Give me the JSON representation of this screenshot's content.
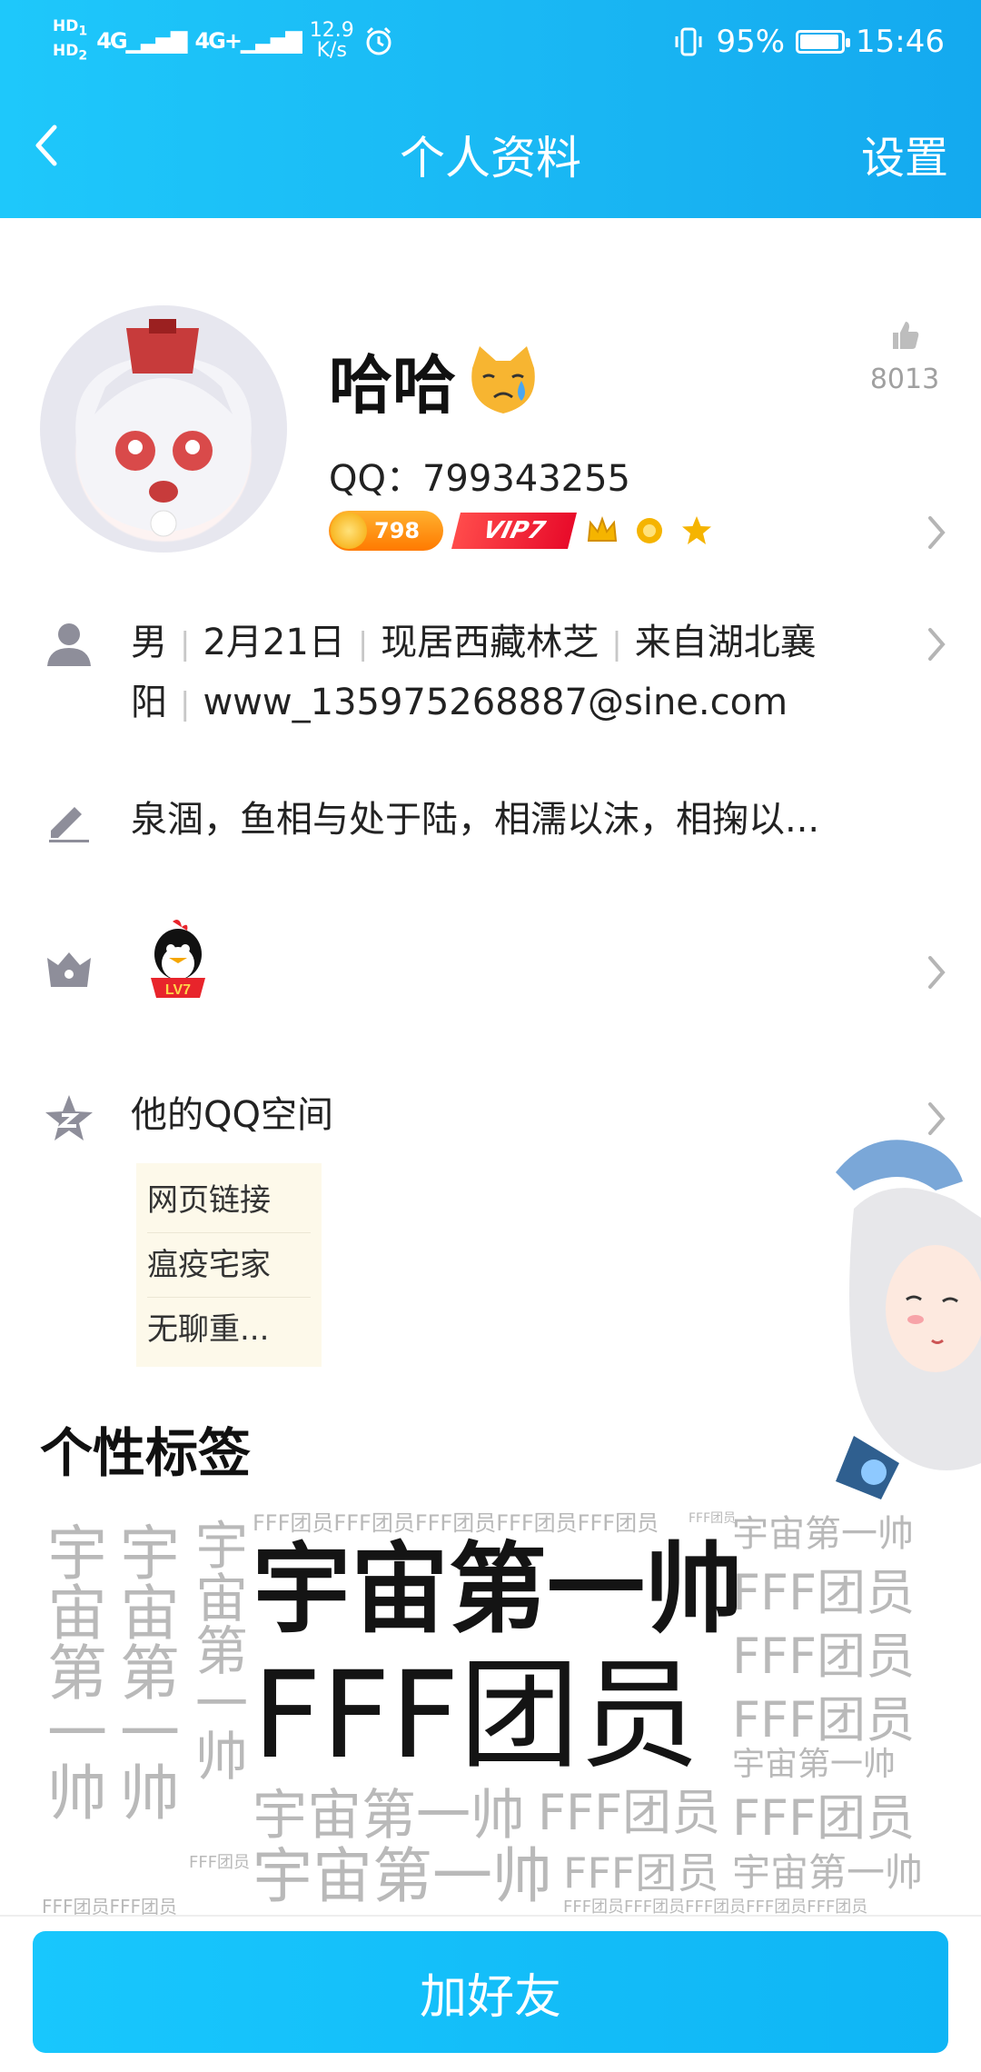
{
  "status_bar": {
    "hd1": "HD",
    "hd1_sub": "1",
    "hd2": "HD",
    "hd2_sub": "2",
    "net1": "4G",
    "net2": "4G+",
    "speed_value": "12.9",
    "speed_unit": "K/s",
    "battery": "95%",
    "battery_level": 0.95,
    "time": "15:46"
  },
  "nav": {
    "title": "个人资料",
    "settings": "设置"
  },
  "profile": {
    "name": "哈哈",
    "emoji": "crying-cat-emoji",
    "qq": "QQ：799343255",
    "likes": "8013",
    "coin_badge": "798",
    "vip_badge": "VIP7",
    "accent": "#19b6f3"
  },
  "info": {
    "gender": "男",
    "birthday": "2月21日",
    "location": "现居西藏林芝",
    "hometown_line1": "来自湖北襄",
    "hometown_line2": "阳",
    "email": "www_135975268887@sine.com"
  },
  "signature": "泉涸，鱼相与处于陆，相濡以沫，相掬以...",
  "qzone": {
    "title": "他的QQ空间",
    "items": [
      "网页链接",
      "瘟疫宅家",
      "无聊重..."
    ]
  },
  "tags": {
    "title": "个性标签",
    "primary_1": "宇宙第一帅",
    "primary_2": "FFF团员",
    "tiny_row": "FFF团员FFF团员FFF团员FFF团员FFF团员",
    "tiny_row_small": "FFF团员",
    "tag1": "宇宙第一帅",
    "tag2": "FFF团员",
    "vert_left_1": "宇宙第一帅",
    "vert_left_2": "宇宙第一帅",
    "vert_col": "宇宙第一帅",
    "bottom_left": "FFF团员FFF团员",
    "bottom_right": "FFF团员FFF团员FFF团员FFF团员FFF团员"
  },
  "actions": {
    "add_friend": "加好友"
  }
}
